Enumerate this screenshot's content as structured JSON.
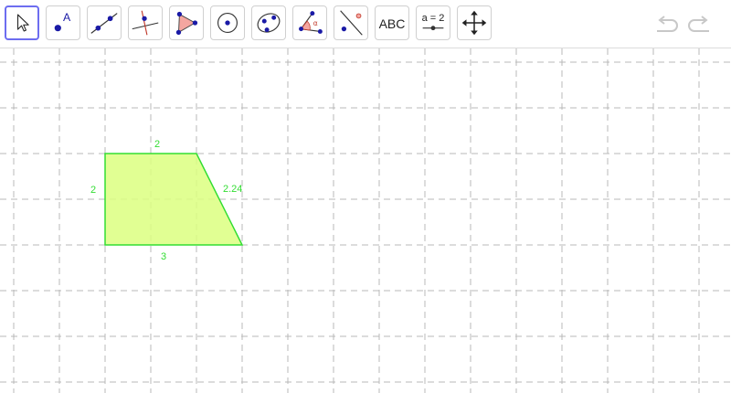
{
  "toolbar": {
    "tools": [
      {
        "name": "move-tool",
        "icon": "cursor-arrow-icon"
      },
      {
        "name": "point-tool",
        "icon": "point-with-label-icon",
        "label": "A"
      },
      {
        "name": "line-tool",
        "icon": "line-through-two-points-icon"
      },
      {
        "name": "perpendicular-line-tool",
        "icon": "perpendicular-line-icon"
      },
      {
        "name": "polygon-tool",
        "icon": "polygon-icon"
      },
      {
        "name": "circle-tool",
        "icon": "circle-with-center-icon"
      },
      {
        "name": "ellipse-tool",
        "icon": "ellipse-icon"
      },
      {
        "name": "angle-tool",
        "icon": "angle-icon",
        "label": "α"
      },
      {
        "name": "reflect-tool",
        "icon": "reflect-about-line-icon"
      },
      {
        "name": "text-tool",
        "icon": "text-icon",
        "label": "ABC"
      },
      {
        "name": "slider-tool",
        "icon": "slider-icon",
        "label": "a = 2"
      },
      {
        "name": "move-graphics-view-tool",
        "icon": "move-view-arrows-icon"
      }
    ],
    "undo_icon": "undo-icon",
    "redo_icon": "redo-icon"
  },
  "canvas": {
    "grid": "dashed",
    "shape": {
      "type": "trapezoid",
      "fill_color": "#dcff80",
      "stroke_color": "#33dd33",
      "side_labels": {
        "top": "2",
        "left": "2",
        "slant": "2.24",
        "bottom": "3"
      }
    }
  },
  "colors": {
    "accent": "#6d6df0",
    "point": "#1a1aa6",
    "shape_stroke": "#33dd33"
  }
}
